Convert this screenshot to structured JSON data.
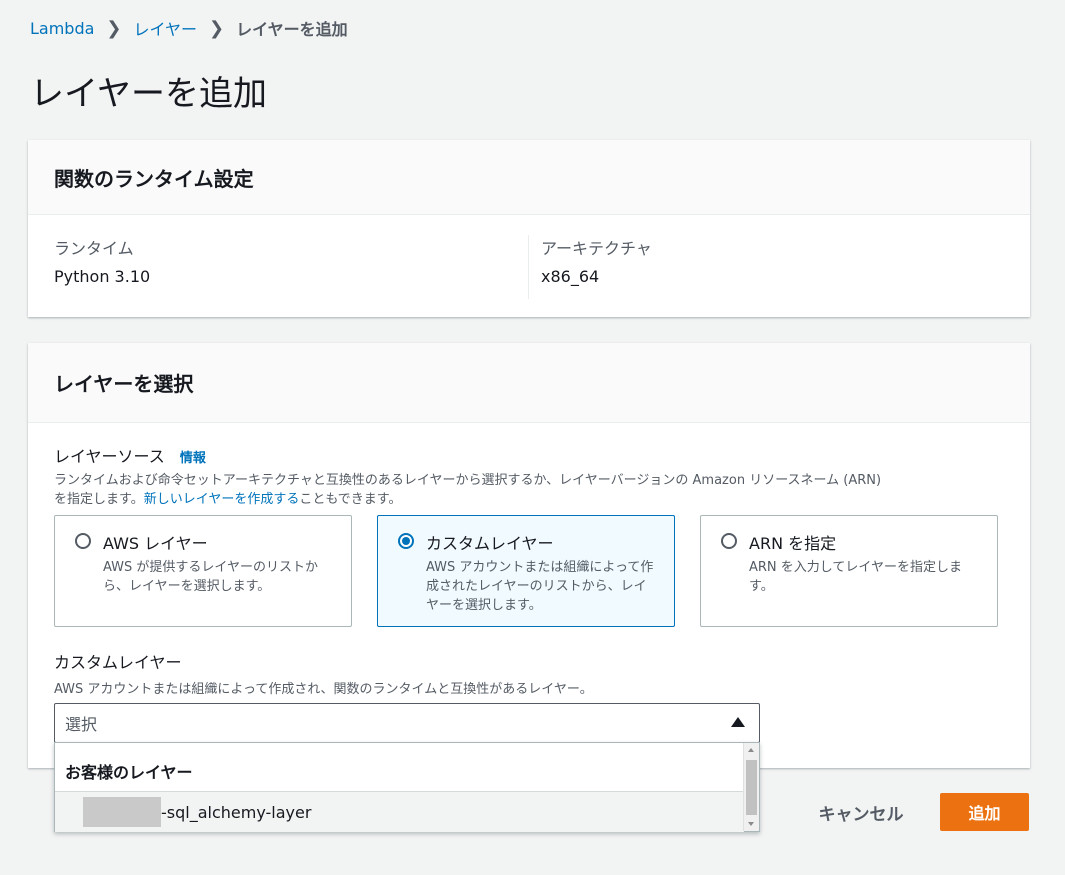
{
  "breadcrumb": {
    "items": [
      "Lambda",
      "レイヤー"
    ],
    "current": "レイヤーを追加"
  },
  "page_title": "レイヤーを追加",
  "runtime_settings": {
    "title": "関数のランタイム設定",
    "runtime_label": "ランタイム",
    "runtime_value": "Python 3.10",
    "architecture_label": "アーキテクチャ",
    "architecture_value": "x86_64"
  },
  "layer_select": {
    "title": "レイヤーを選択",
    "source_label": "レイヤーソース",
    "info_link": "情報",
    "desc_line1": "ランタイムおよび命令セットアーキテクチャと互換性のあるレイヤーから選択するか、レイヤーバージョンの Amazon リソースネーム (ARN)",
    "desc_pre": "を指定します。",
    "desc_link": "新しいレイヤーを作成する",
    "desc_post": "こともできます。",
    "tiles": [
      {
        "title": "AWS レイヤー",
        "desc": "AWS が提供するレイヤーのリストから、レイヤーを選択します。",
        "selected": false
      },
      {
        "title": "カスタムレイヤー",
        "desc": "AWS アカウントまたは組織によって作成されたレイヤーのリストから、レイヤーを選択します。",
        "selected": true
      },
      {
        "title": "ARN を指定",
        "desc": "ARN を入力してレイヤーを指定します。",
        "selected": false
      }
    ],
    "custom_label": "カスタムレイヤー",
    "custom_desc": "AWS アカウントまたは組織によって作成され、関数のランタイムと互換性があるレイヤー。",
    "select_placeholder": "選択",
    "dropdown": {
      "group_label": "お客様のレイヤー",
      "options": [
        "-sql_alchemy-layer"
      ]
    }
  },
  "actions": {
    "cancel": "キャンセル",
    "add": "追加"
  },
  "colors": {
    "link": "#0073bb",
    "primary": "#ec7211",
    "selected_bg": "#f1faff"
  }
}
